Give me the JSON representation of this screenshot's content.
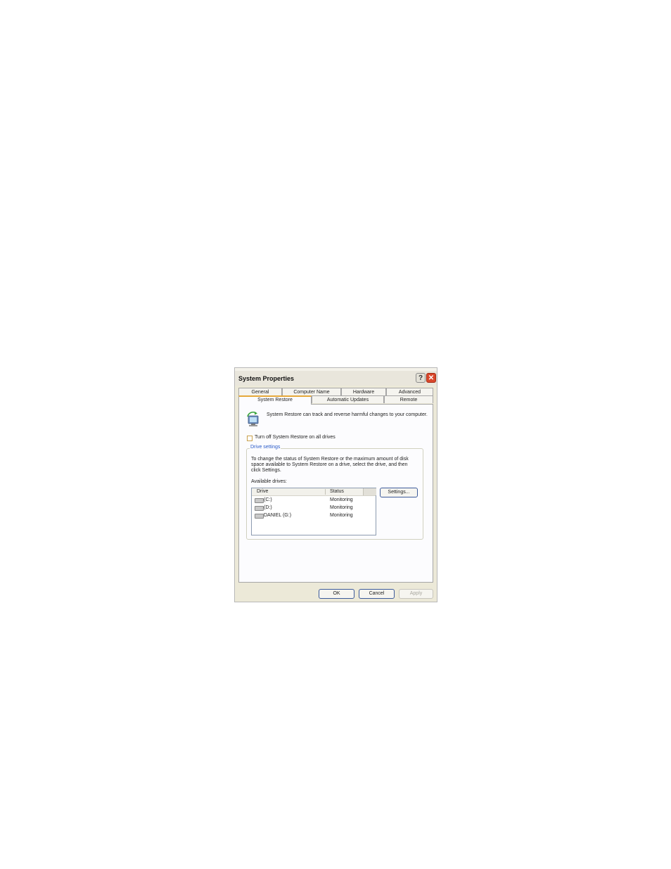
{
  "window": {
    "title": "System Properties",
    "help_label": "?",
    "close_label": "✕"
  },
  "tabs": {
    "row1": [
      "General",
      "Computer Name",
      "Hardware",
      "Advanced"
    ],
    "row2": [
      "System Restore",
      "Automatic Updates",
      "Remote"
    ],
    "active": "System Restore"
  },
  "restore": {
    "intro": "System Restore can track and reverse harmful changes to your computer.",
    "turn_off_label": "Turn off System Restore on all drives",
    "turn_off_checked": false
  },
  "drive_settings": {
    "legend": "Drive settings",
    "description": "To change the status of System Restore or the maximum amount of disk space available to System Restore on a drive, select the drive, and then click Settings.",
    "available_label": "Available drives:",
    "columns": {
      "drive": "Drive",
      "status": "Status"
    },
    "drives": [
      {
        "name": "(C:)",
        "status": "Monitoring"
      },
      {
        "name": "(D:)",
        "status": "Monitoring"
      },
      {
        "name": "DANIEL (G:)",
        "status": "Monitoring"
      }
    ],
    "settings_button": "Settings..."
  },
  "footer": {
    "ok": "OK",
    "cancel": "Cancel",
    "apply": "Apply"
  },
  "colors": {
    "active_tab_accent": "#e6a83a",
    "close_button": "#d9472b",
    "legend_text": "#2a5bc9"
  },
  "icons": {
    "restore": "system-restore-icon",
    "drive": "hard-drive-icon"
  }
}
